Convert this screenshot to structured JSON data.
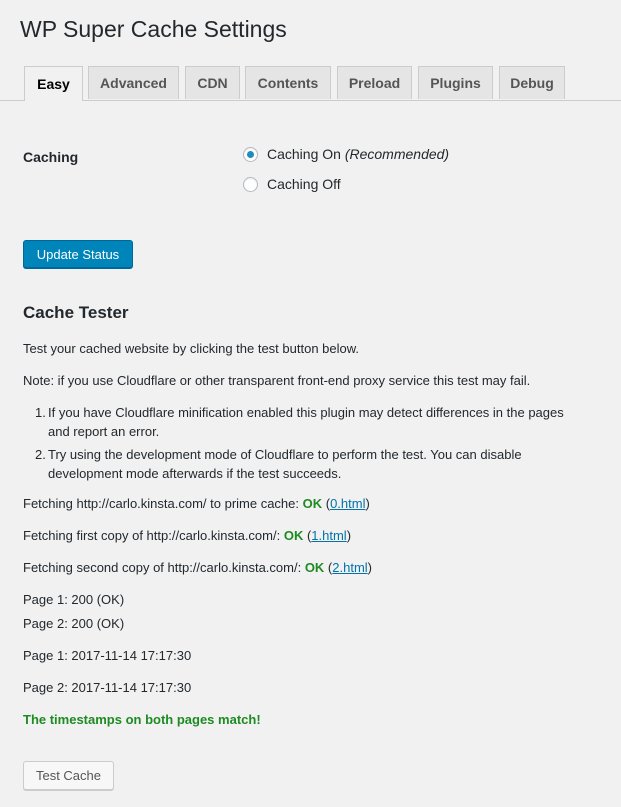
{
  "title": "WP Super Cache Settings",
  "tabs": [
    {
      "label": "Easy"
    },
    {
      "label": "Advanced"
    },
    {
      "label": "CDN"
    },
    {
      "label": "Contents"
    },
    {
      "label": "Preload"
    },
    {
      "label": "Plugins"
    },
    {
      "label": "Debug"
    }
  ],
  "caching": {
    "label": "Caching",
    "on_label": "Caching On",
    "on_note": "(Recommended)",
    "off_label": "Caching Off",
    "selected": "on"
  },
  "update_button": "Update Status",
  "tester": {
    "heading": "Cache Tester",
    "intro": "Test your cached website by clicking the test button below.",
    "note": "Note: if you use Cloudflare or other transparent front-end proxy service this test may fail.",
    "list": [
      {
        "num": "1.",
        "line1": "If you have Cloudflare minification enabled this plugin may detect differences in the pages",
        "line2": "and report an error."
      },
      {
        "num": "2.",
        "line1": "Try using the development mode of Cloudflare to perform the test. You can disable",
        "line2": "development mode afterwards if the test succeeds."
      }
    ],
    "fetch": [
      {
        "text": "Fetching http://carlo.kinsta.com/ to prime cache: ",
        "status": "OK",
        "link": "0.html"
      },
      {
        "text": "Fetching first copy of http://carlo.kinsta.com/: ",
        "status": "OK",
        "link": "1.html"
      },
      {
        "text": "Fetching second copy of http://carlo.kinsta.com/: ",
        "status": "OK",
        "link": "2.html"
      }
    ],
    "page1_status": "Page 1: 200 (OK)",
    "page2_status": "Page 2: 200 (OK)",
    "page1_time": "Page 1: 2017-11-14 17:17:30",
    "page2_time": "Page 2: 2017-11-14 17:17:30",
    "match": "The timestamps on both pages match!",
    "test_button": "Test Cache"
  },
  "colors": {
    "primary": "#0085ba",
    "ok": "#1d8b22",
    "link": "#0073aa"
  }
}
